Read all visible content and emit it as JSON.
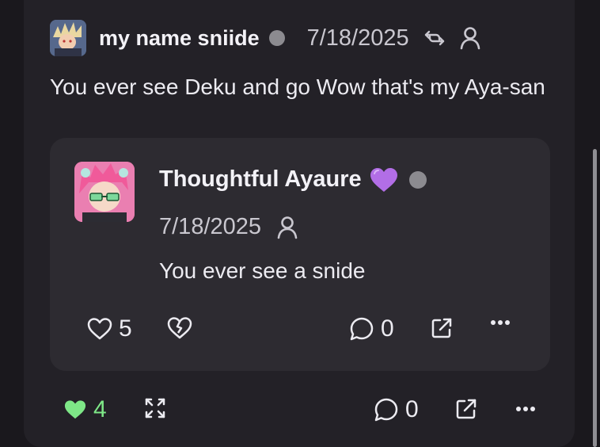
{
  "post": {
    "author": "my name sniide",
    "date": "7/18/2025",
    "text": "You ever see Deku and go Wow that's my Aya-san",
    "like_count": "4",
    "reply_count": "0"
  },
  "quoted_post": {
    "author": "Thoughtful Ayaure",
    "author_emoji": "💜",
    "date": "7/18/2025",
    "text": "You ever see a snide",
    "like_count": "5",
    "reply_count": "0"
  },
  "colors": {
    "background": "#1a181d",
    "card": "#232127",
    "quote_card": "#2d2b31",
    "liked_green": "#7ee787",
    "muted": "#c9c7cf",
    "status_dot": "#8c8b90"
  },
  "icons": [
    "repost-icon",
    "person-icon",
    "heart-icon",
    "heart-crack-icon",
    "comment-icon",
    "external-link-icon",
    "more-icon",
    "expand-icon"
  ]
}
